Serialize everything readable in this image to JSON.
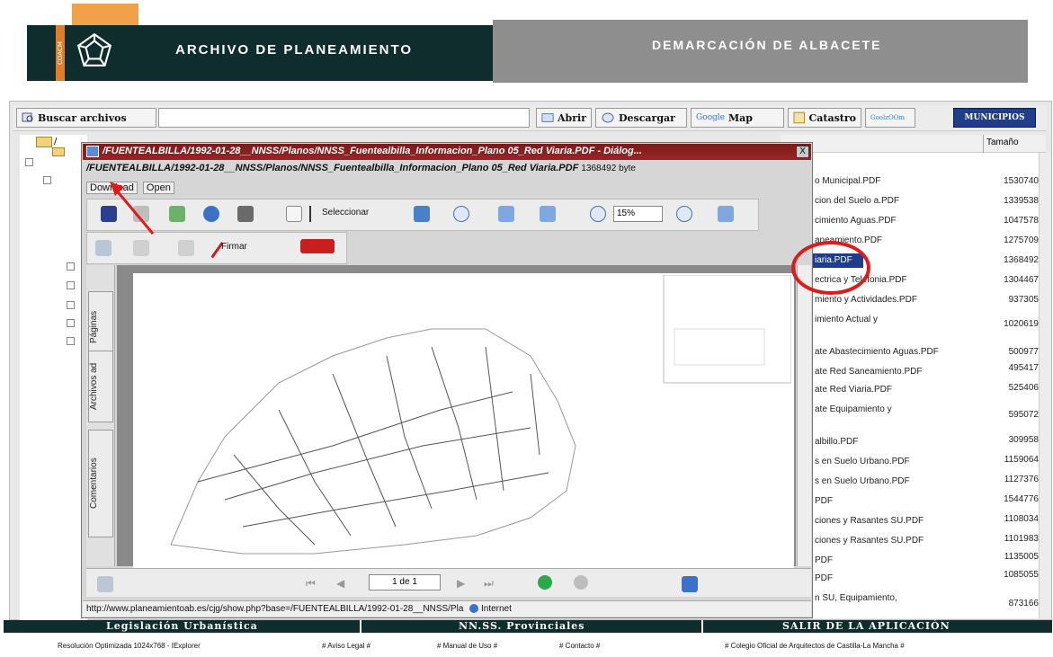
{
  "header": {
    "side_label": "COACM",
    "title": "ARCHIVO DE PLANEAMIENTO",
    "right_title": "DEMARCACIÓN DE ALBACETE"
  },
  "toolbar": {
    "search_label": "Buscar archivos",
    "search_value": "",
    "open_label": "Abrir",
    "download_label": "Descargar",
    "google_label": "Google",
    "map_label": "Map",
    "catastro_label": "Catastro",
    "goolzoom_label": "GoolzOOm",
    "municipios_label": "MUNICIPIOS"
  },
  "tree": {
    "root_label": "/"
  },
  "files": {
    "size_header": "Tamaño",
    "items": [
      {
        "name": "o Municipal.PDF",
        "size": "1530740"
      },
      {
        "name": "cion del Suelo a.PDF",
        "size": "1339538"
      },
      {
        "name": "cimiento Aguas.PDF",
        "size": "1047578"
      },
      {
        "name": "aneamiento.PDF",
        "size": "1275709"
      },
      {
        "name": "iaria.PDF",
        "size": "1368492"
      },
      {
        "name": "ectrica y Telefonia.PDF",
        "size": "1304467"
      },
      {
        "name": "miento y Actividades.PDF",
        "size": "937305"
      },
      {
        "name": "imiento Actual y",
        "size": "1020619"
      },
      {
        "name": "ate Abastecimiento Aguas.PDF",
        "size": "500977"
      },
      {
        "name": "ate Red Saneamiento.PDF",
        "size": "495417"
      },
      {
        "name": "ate Red Viaria.PDF",
        "size": "525406"
      },
      {
        "name": "ate Equipamiento y",
        "size": "595072"
      },
      {
        "name": "albillo.PDF",
        "size": "309958"
      },
      {
        "name": "s en Suelo Urbano.PDF",
        "size": "1159064"
      },
      {
        "name": "s en Suelo Urbano.PDF",
        "size": "1127376"
      },
      {
        "name": "PDF",
        "size": "1544776"
      },
      {
        "name": "ciones y Rasantes SU.PDF",
        "size": "1108034"
      },
      {
        "name": "ciones y Rasantes SU.PDF",
        "size": "1101983"
      },
      {
        "name": "PDF",
        "size": "1135005"
      },
      {
        "name": "PDF",
        "size": "1085055"
      },
      {
        "name": "n SU, Equipamiento,",
        "size": "873166"
      }
    ]
  },
  "dialog": {
    "title": "/FUENTEALBILLA/1992-01-28__NNSS/Planos/NNSS_Fuentealbilla_Informacion_Plano 05_Red Viaria.PDF - Diálog...",
    "close_label": "X",
    "path": "/FUENTEALBILLA/1992-01-28__NNSS/Planos/NNSS_Fuentealbilla_Informacion_Plano 05_Red Viaria.PDF",
    "path_size": "1368492 byte",
    "download_menu": "Download",
    "open_menu": "Open",
    "select_label": "Seleccionar",
    "zoom_value": "15%",
    "sign_label": "Firmar",
    "sidetabs": [
      "Páginas",
      "Archivos ad",
      "Comentarios"
    ],
    "page_indicator": "1 de 1",
    "status_url": "http://www.planeamientoab.es/cjg/show.php?base=/FUENTEALBILLA/1992-01-28__NNSS/Pla",
    "status_zone": "Internet"
  },
  "bottom_bar": {
    "link1": "Legislación Urbanística",
    "link2": "NN.SS. Provinciales",
    "link3": "SALIR DE LA APLICACIÓN"
  },
  "footer": {
    "resolution": "Resolución Optimizada 1024x768 - IExplorer",
    "aviso": "# Aviso Legal #",
    "manual": "# Manual de Uso #",
    "contacto": "# Contacto #",
    "colegio": "# Colegio Oficial de Arquitectos de Castilla-La Mancha #"
  },
  "colors": {
    "banner_dark": "#0e2d2c",
    "banner_grey": "#8e8e8e",
    "accent_orange": "#f0a14a",
    "dialog_title": "#9c2424",
    "annotation_red": "#e01a1a"
  }
}
